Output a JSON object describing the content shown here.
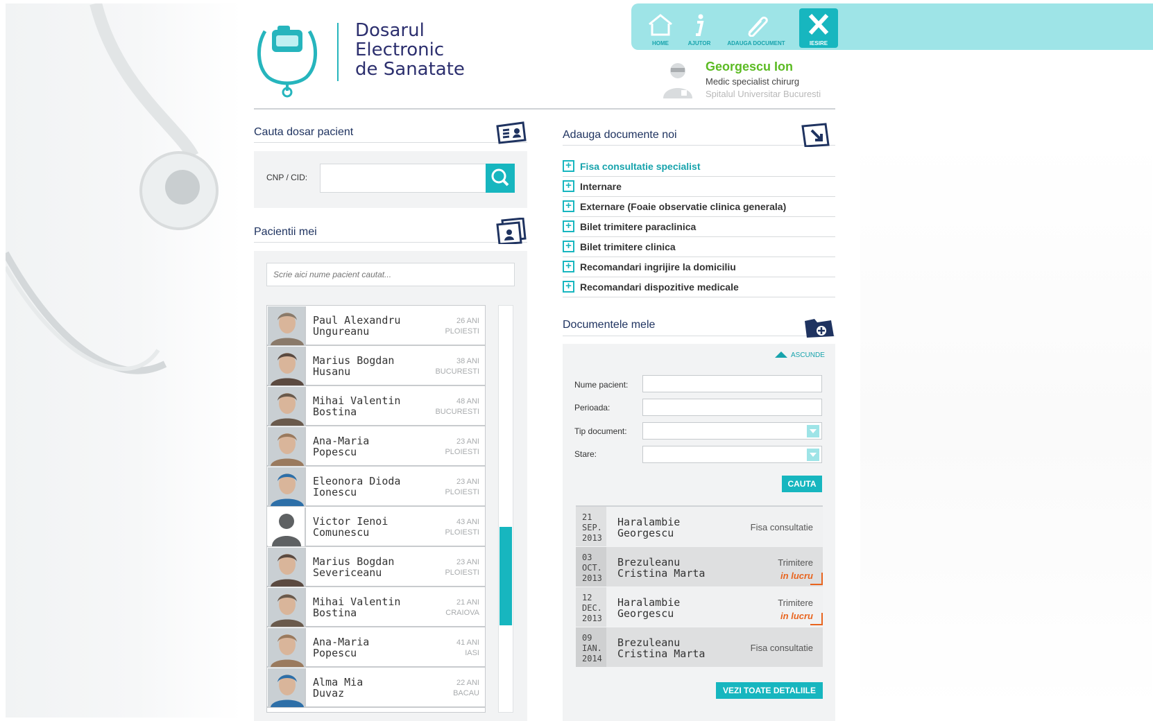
{
  "brand": {
    "line1": "Dosarul",
    "line2": "Electronic",
    "line3": "de Sanatate"
  },
  "topnav": [
    {
      "label": "HOME",
      "icon": "home-icon"
    },
    {
      "label": "AJUTOR",
      "icon": "info-icon"
    },
    {
      "label": "ADAUGA DOCUMENT",
      "icon": "paperclip-icon"
    },
    {
      "label": "IESIRE",
      "icon": "close-icon"
    }
  ],
  "user": {
    "name": "Georgescu Ion",
    "role": "Medic specialist chirurg",
    "hospital": "Spitalul Universitar Bucuresti"
  },
  "search": {
    "title": "Cauta dosar pacient",
    "cnp_label": "CNP / CID:",
    "cnp_value": ""
  },
  "patients": {
    "title": "Pacientii mei",
    "search_placeholder": "Scrie aici nume pacient cautat...",
    "scroll_position": 0.72,
    "items": [
      {
        "first": "Paul Alexandru",
        "last": "Ungureanu",
        "age": "26 ANI",
        "city": "PLOIESTI",
        "photo": "patient-photo"
      },
      {
        "first": "Marius Bogdan",
        "last": "Husanu",
        "age": "38 ANI",
        "city": "BUCURESTI",
        "photo": "patient-photo"
      },
      {
        "first": "Mihai Valentin",
        "last": "Bostina",
        "age": "48 ANI",
        "city": "BUCURESTI",
        "photo": "patient-photo"
      },
      {
        "first": "Ana-Maria",
        "last": "Popescu",
        "age": "23 ANI",
        "city": "PLOIESTI",
        "photo": "patient-photo"
      },
      {
        "first": "Eleonora Dioda",
        "last": "Ionescu",
        "age": "23 ANI",
        "city": "PLOIESTI",
        "photo": "patient-photo"
      },
      {
        "first": "Victor Ienoi",
        "last": "Comunescu",
        "age": "43 ANI",
        "city": "PLOIESTI",
        "photo": "user-placeholder-icon"
      },
      {
        "first": "Marius Bogdan",
        "last": "Severiceanu",
        "age": "23 ANI",
        "city": "PLOIESTI",
        "photo": "patient-photo"
      },
      {
        "first": "Mihai Valentin",
        "last": "Bostina",
        "age": "21 ANI",
        "city": "CRAIOVA",
        "photo": "patient-photo"
      },
      {
        "first": "Ana-Maria",
        "last": "Popescu",
        "age": "41 ANI",
        "city": "IASI",
        "photo": "patient-photo"
      },
      {
        "first": "Alma Mia",
        "last": "Duvaz",
        "age": "22 ANI",
        "city": "BACAU",
        "photo": "patient-photo"
      }
    ]
  },
  "add_docs": {
    "title": "Adauga documente noi",
    "items": [
      "Fisa consultatie specialist",
      "Internare",
      "Externare (Foaie observatie clinica generala)",
      "Bilet trimitere paraclinica",
      "Bilet trimitere clinica",
      "Recomandari ingrijire la domiciliu",
      "Recomandari dispozitive medicale"
    ]
  },
  "my_docs": {
    "title": "Documentele mele",
    "hide_label": "ASCUNDE",
    "filters": {
      "patient_label": "Nume pacient:",
      "period_label": "Perioada:",
      "type_label": "Tip document:",
      "state_label": "Stare:",
      "patient_value": "",
      "period_value": "",
      "type_value": "",
      "state_value": ""
    },
    "search_button": "CAUTA",
    "results": [
      {
        "day": "21",
        "month": "SEP.",
        "year": "2013",
        "first": "Haralambie",
        "last": "Georgescu",
        "type": "Fisa consultatie",
        "status": ""
      },
      {
        "day": "03",
        "month": "OCT.",
        "year": "2013",
        "first": "Brezuleanu",
        "last": "Cristina Marta",
        "type": "Trimitere",
        "status": "in lucru"
      },
      {
        "day": "12",
        "month": "DEC.",
        "year": "2013",
        "first": "Haralambie",
        "last": "Georgescu",
        "type": "Trimitere",
        "status": "in lucru"
      },
      {
        "day": "09",
        "month": "IAN.",
        "year": "2014",
        "first": "Brezuleanu",
        "last": "Cristina Marta",
        "type": "Fisa consultatie",
        "status": ""
      }
    ],
    "details_button": "VEZI TOATE DETALIILE"
  },
  "colors": {
    "accent": "#17b6bf",
    "topbar": "#9ee4e7",
    "brand": "#2c2f6e",
    "user_name": "#5cbb24",
    "status": "#e8641e"
  }
}
